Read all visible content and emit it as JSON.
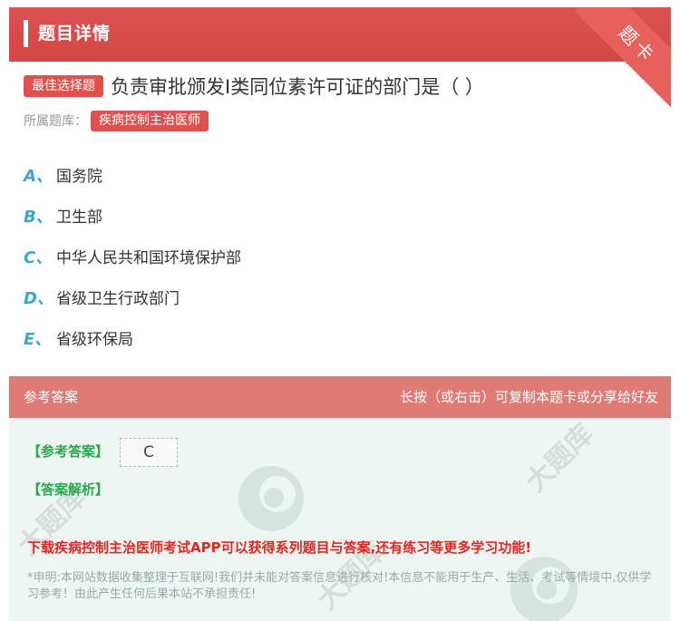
{
  "header": {
    "title": "题目详情",
    "corner_badge": "题卡"
  },
  "question": {
    "type_tag": "最佳选择题",
    "text": "负责审批颁发I类同位素许可证的部门是（ ）"
  },
  "library": {
    "label": "所属题库：",
    "tag": "疾病控制主治医师"
  },
  "options": [
    {
      "letter": "A、",
      "text": "国务院"
    },
    {
      "letter": "B、",
      "text": "卫生部"
    },
    {
      "letter": "C、",
      "text": "中华人民共和国环境保护部"
    },
    {
      "letter": "D、",
      "text": "省级卫生行政部门"
    },
    {
      "letter": "E、",
      "text": "省级环保局"
    }
  ],
  "answer_section": {
    "title": "参考答案",
    "hint": "长按（或右击）可复制本题卡或分享给好友",
    "answer_label": "【参考答案】",
    "answer_value": "C",
    "analysis_label": "【答案解析】",
    "promo": "下载疾病控制主治医师考试APP可以获得系列题目与答案,还有练习等更多学习功能!",
    "disclaimer": "*申明:本网站数据收集整理于互联网!我们并未能对答案信息进行核对!本信息不能用于生产、生活、考试等情境中,仅供学习参考！由此产生任何后果本站不承担责任!"
  },
  "colors": {
    "brand_red": "#d9534f",
    "option_letter": "#3aa8c8",
    "answer_green": "#2aa84a",
    "promo_red": "#e8251e"
  }
}
